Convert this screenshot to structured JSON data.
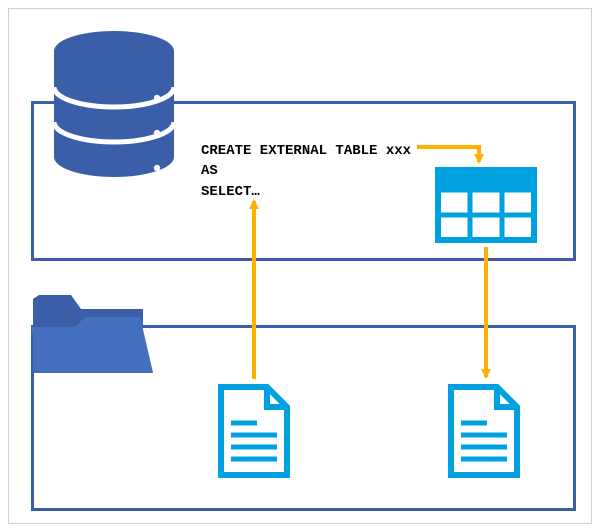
{
  "sql": {
    "line1": "CREATE EXTERNAL TABLE xxx",
    "line2": "AS",
    "line3": "SELECT…"
  },
  "colors": {
    "navy": "#3a5ea8",
    "cyan": "#00a1e0",
    "arrow": "#ffb000",
    "white": "#ffffff"
  },
  "icons": {
    "database": "database-icon",
    "folder": "folder-icon",
    "table": "table-icon",
    "file_left": "document-icon",
    "file_right": "document-icon"
  },
  "arrows": [
    {
      "from": "sql-text",
      "to": "table-icon"
    },
    {
      "from": "table-icon",
      "to": "file-right"
    },
    {
      "from": "file-left",
      "to": "sql-text"
    }
  ]
}
